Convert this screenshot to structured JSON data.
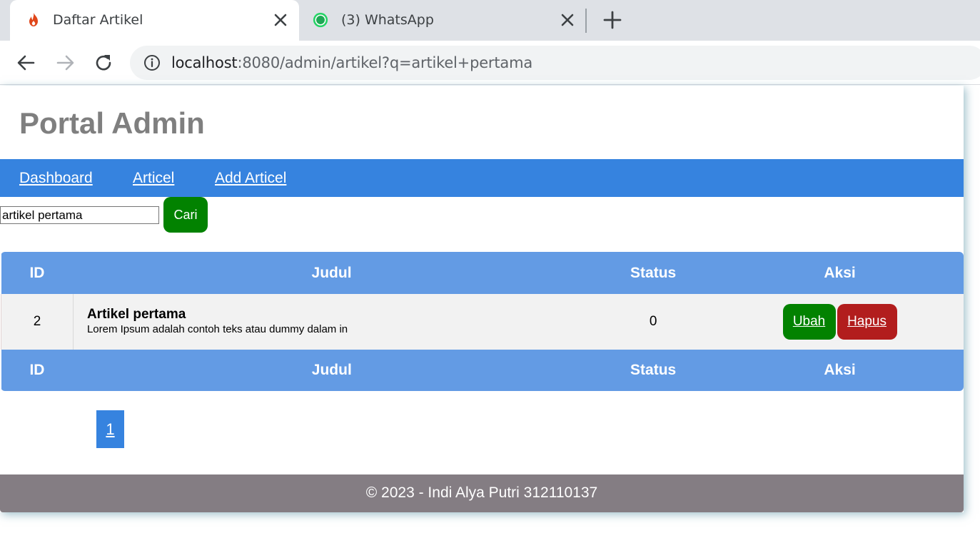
{
  "browser": {
    "tabs": [
      {
        "title": "Daftar Artikel",
        "favicon": "codeigniter-flame-icon",
        "active": true
      },
      {
        "title": "(3) WhatsApp",
        "favicon": "whatsapp-icon",
        "badge": "3",
        "active": false
      }
    ],
    "url_host": "localhost",
    "url_rest": ":8080/admin/artikel?q=artikel+pertama"
  },
  "colors": {
    "navbar": "#3683df",
    "table_header": "#639be4",
    "button_green": "#028200",
    "button_red": "#b21d1d",
    "footer": "#847d83",
    "title": "#7f7f7f"
  },
  "header": {
    "title": "Portal Admin"
  },
  "nav": {
    "items": [
      {
        "label": "Dashboard"
      },
      {
        "label": "Articel"
      },
      {
        "label": "Add Articel"
      }
    ]
  },
  "search": {
    "value": "artikel pertama",
    "button_label": "Cari"
  },
  "table": {
    "columns": [
      "ID",
      "Judul",
      "Status",
      "Aksi"
    ],
    "rows": [
      {
        "id": "2",
        "title": "Artikel pertama",
        "excerpt": "Lorem Ipsum adalah contoh teks atau dummy dalam in",
        "status": "0",
        "edit_label": "Ubah",
        "delete_label": "Hapus"
      }
    ]
  },
  "pagination": {
    "pages": [
      "1"
    ],
    "current": "1"
  },
  "footer": {
    "text": "© 2023 - Indi Alya Putri 312110137"
  }
}
